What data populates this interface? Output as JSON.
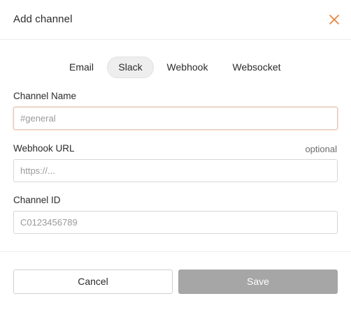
{
  "dialog": {
    "title": "Add channel",
    "close_icon": "close-icon",
    "accent_color": "#e8803a"
  },
  "tabs": [
    {
      "label": "Email",
      "active": false
    },
    {
      "label": "Slack",
      "active": true
    },
    {
      "label": "Webhook",
      "active": false
    },
    {
      "label": "Websocket",
      "active": false
    }
  ],
  "fields": {
    "channel_name": {
      "label": "Channel Name",
      "value": "",
      "placeholder": "#general"
    },
    "webhook_url": {
      "label": "Webhook URL",
      "optional_label": "optional",
      "value": "",
      "placeholder": "https://..."
    },
    "channel_id": {
      "label": "Channel ID",
      "value": "",
      "placeholder": "C0123456789"
    }
  },
  "footer": {
    "cancel_label": "Cancel",
    "save_label": "Save"
  }
}
